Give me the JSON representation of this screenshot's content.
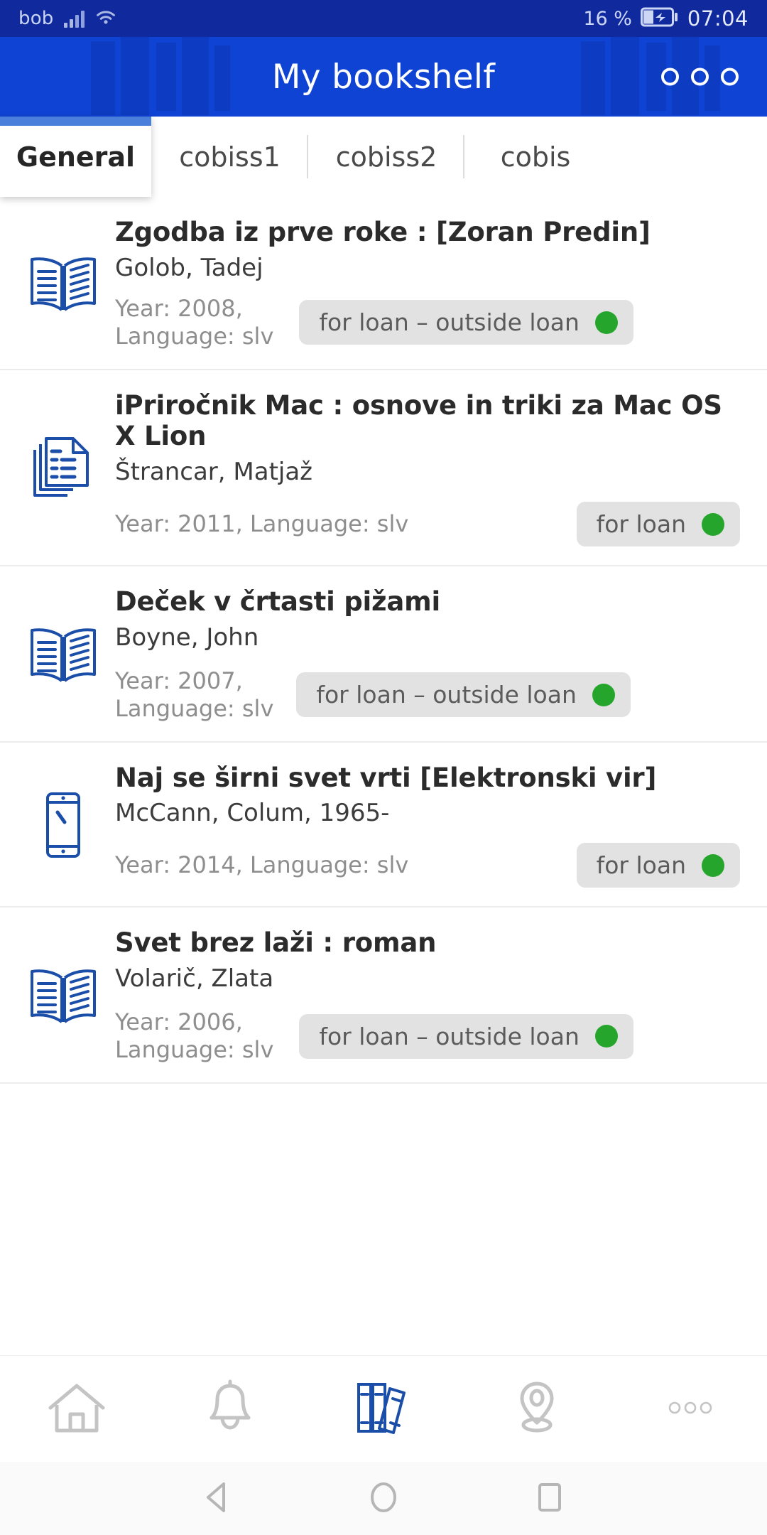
{
  "status_bar": {
    "carrier": "bob",
    "signal_icon": "signal-bars-icon",
    "wifi_icon": "wifi-icon",
    "battery_percent": "16 %",
    "battery_icon": "battery-charging-icon",
    "time": "07:04"
  },
  "header": {
    "title": "My bookshelf",
    "overflow_icon": "overflow-menu-icon",
    "background_icon": "book-spines-pattern",
    "bg_color": "#0f43d4"
  },
  "tabs": {
    "items": [
      {
        "label": "General",
        "active": true
      },
      {
        "label": "cobiss1",
        "active": false
      },
      {
        "label": "cobiss2",
        "active": false
      },
      {
        "label": "cobis",
        "active": false
      }
    ],
    "indicator_color": "#4a7fdb"
  },
  "list": {
    "items": [
      {
        "icon": "open-book-icon",
        "title": "Zgodba iz prve roke : [Zoran Predin]",
        "author": "Golob, Tadej",
        "meta": "Year: 2008,\nLanguage: slv",
        "meta_year": "Year: 2008,",
        "meta_language": "Language: slv",
        "status_label": "for loan – outside loan",
        "status_color": "#25a52b"
      },
      {
        "icon": "documents-icon",
        "title": "iPriročnik Mac : osnove in triki za Mac OS X Lion",
        "author": "Štrancar, Matjaž",
        "meta": "Year: 2011, Language: slv",
        "meta_year": "Year: 2011, Language: slv",
        "meta_language": "",
        "status_label": "for loan",
        "status_color": "#25a52b"
      },
      {
        "icon": "open-book-icon",
        "title": "Deček v črtasti pižami",
        "author": "Boyne, John",
        "meta": "Year: 2007,\nLanguage: slv",
        "meta_year": "Year: 2007,",
        "meta_language": "Language: slv",
        "status_label": "for loan – outside loan",
        "status_color": "#25a52b"
      },
      {
        "icon": "tablet-icon",
        "title": "Naj se širni svet vrti [Elektronski vir]",
        "author": "McCann, Colum, 1965-",
        "meta": "Year: 2014, Language: slv",
        "meta_year": "Year: 2014, Language: slv",
        "meta_language": "",
        "status_label": "for loan",
        "status_color": "#25a52b"
      },
      {
        "icon": "open-book-icon",
        "title": "Svet brez laži : roman",
        "author": "Volarič, Zlata",
        "meta": "Year: 2006,\nLanguage: slv",
        "meta_year": "Year: 2006,",
        "meta_language": "Language: slv",
        "status_label": "for loan – outside loan",
        "status_color": "#25a52b"
      }
    ]
  },
  "bottom_nav": {
    "items": [
      {
        "icon": "home-icon",
        "active": false
      },
      {
        "icon": "bell-icon",
        "active": false
      },
      {
        "icon": "bookshelf-icon",
        "active": true
      },
      {
        "icon": "location-pin-icon",
        "active": false
      },
      {
        "icon": "more-dots-icon",
        "active": false
      }
    ],
    "active_color": "#1b4ea8",
    "inactive_color": "#c4c4c4"
  },
  "android_nav": {
    "back_icon": "back-triangle-icon",
    "home_icon": "home-circle-icon",
    "recents_icon": "recents-square-icon"
  }
}
